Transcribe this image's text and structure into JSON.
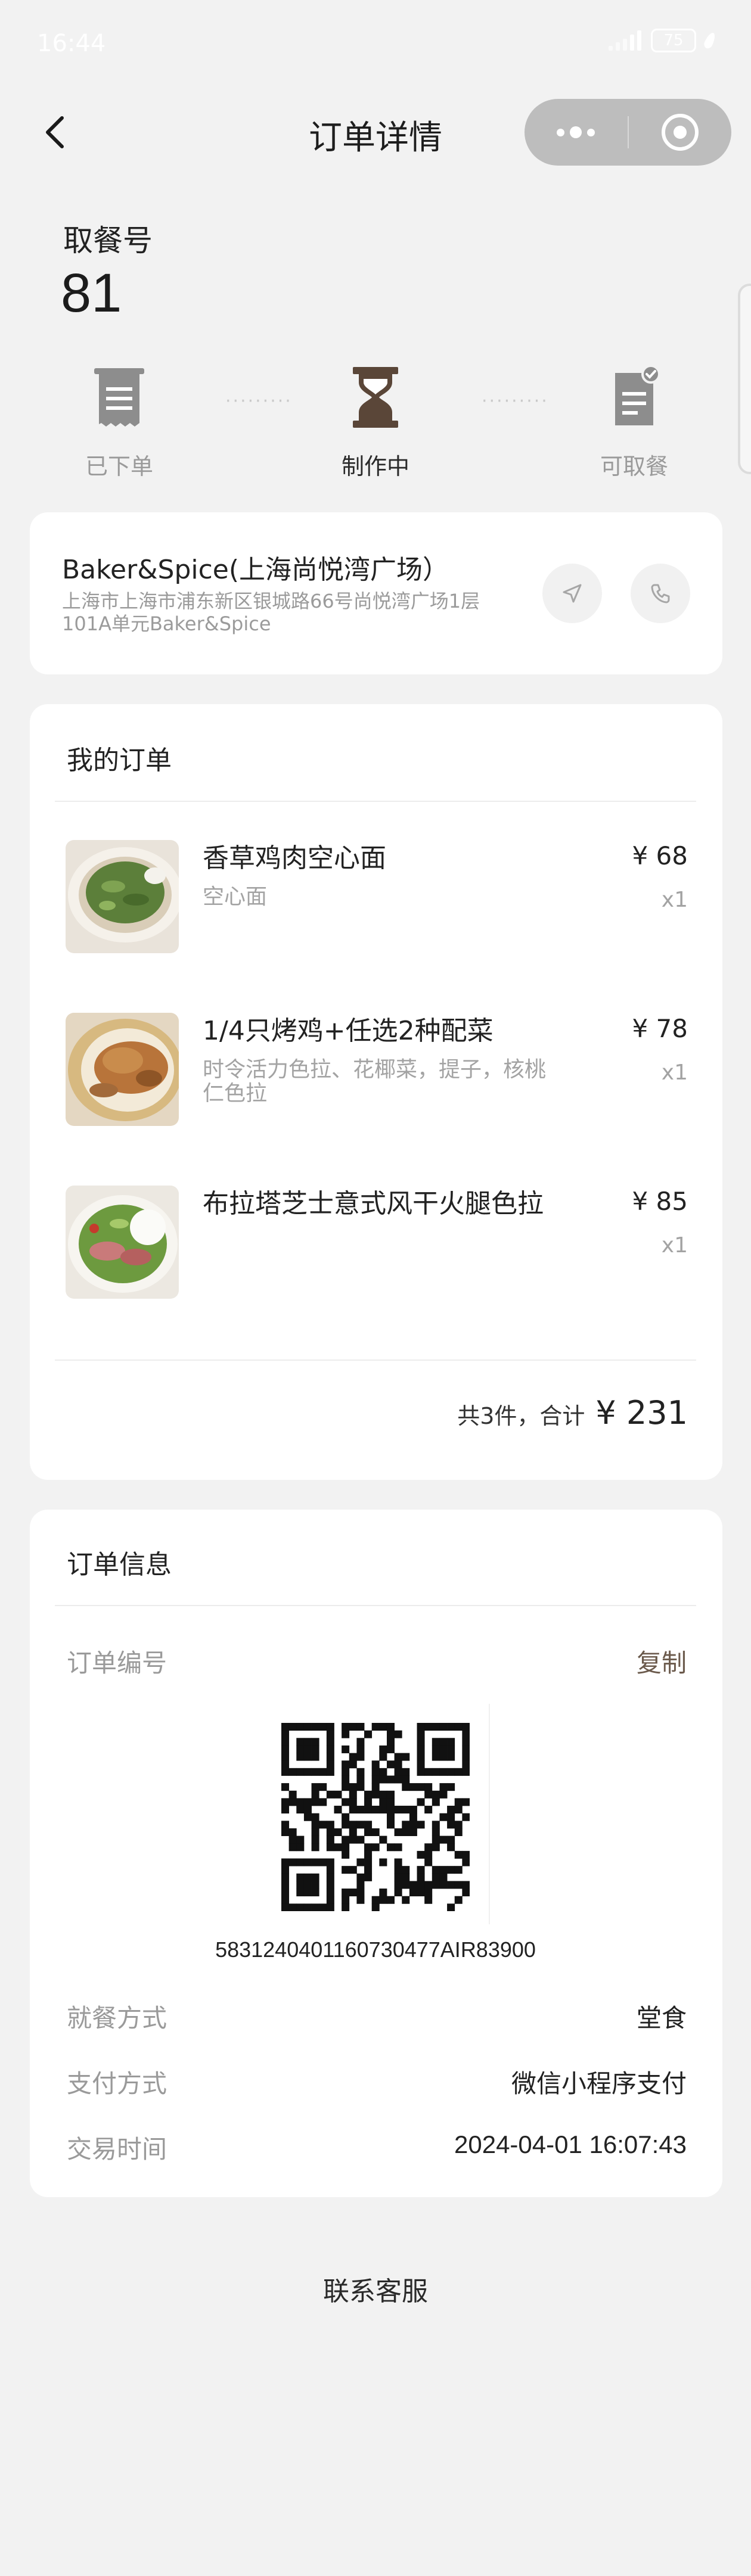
{
  "status_bar": {
    "time": "16:44",
    "battery": "75"
  },
  "nav": {
    "title": "订单详情",
    "more_icon": "more-dots-icon",
    "close_icon": "mini-program-close-icon"
  },
  "pickup": {
    "label": "取餐号",
    "number": "81"
  },
  "steps": [
    {
      "label": "已下单",
      "icon": "receipt-icon",
      "active": false
    },
    {
      "label": "制作中",
      "icon": "hourglass-icon",
      "active": true
    },
    {
      "label": "可取餐",
      "icon": "ready-document-icon",
      "active": false
    }
  ],
  "store": {
    "name": "Baker&Spice(上海尚悦湾广场）",
    "address": "上海市上海市浦东新区银城路66号尚悦湾广场1层101A单元Baker&Spice",
    "nav_icon": "navigation-arrow-icon",
    "phone_icon": "phone-icon"
  },
  "order": {
    "title": "我的订单",
    "items": [
      {
        "name": "香草鸡肉空心面",
        "desc": "空心面",
        "price": "¥ 68",
        "qty": "x1",
        "image": "pasta-dish-image"
      },
      {
        "name": "1/4只烤鸡+任选2种配菜",
        "desc": "时令活力色拉、花椰菜，提子，核桃仁色拉",
        "price": "¥ 78",
        "qty": "x1",
        "image": "roast-chicken-image"
      },
      {
        "name": "布拉塔芝士意式风干火腿色拉",
        "desc": "",
        "price": "¥ 85",
        "qty": "x1",
        "image": "burrata-salad-image"
      }
    ],
    "summary": "共3件，合计",
    "total": "¥ 231"
  },
  "info": {
    "title": "订单信息",
    "order_no_label": "订单编号",
    "copy_label": "复制",
    "order_no": "5831240401160730477AIR83900",
    "dine_label": "就餐方式",
    "dine_value": "堂食",
    "pay_label": "支付方式",
    "pay_value": "微信小程序支付",
    "time_label": "交易时间",
    "time_value": "2024-04-01 16:07:43"
  },
  "contact_label": "联系客服",
  "colors": {
    "background": "#f2f2f2",
    "card": "#ffffff",
    "active_step": "#5a4638",
    "muted_step": "#8a8a8a"
  }
}
